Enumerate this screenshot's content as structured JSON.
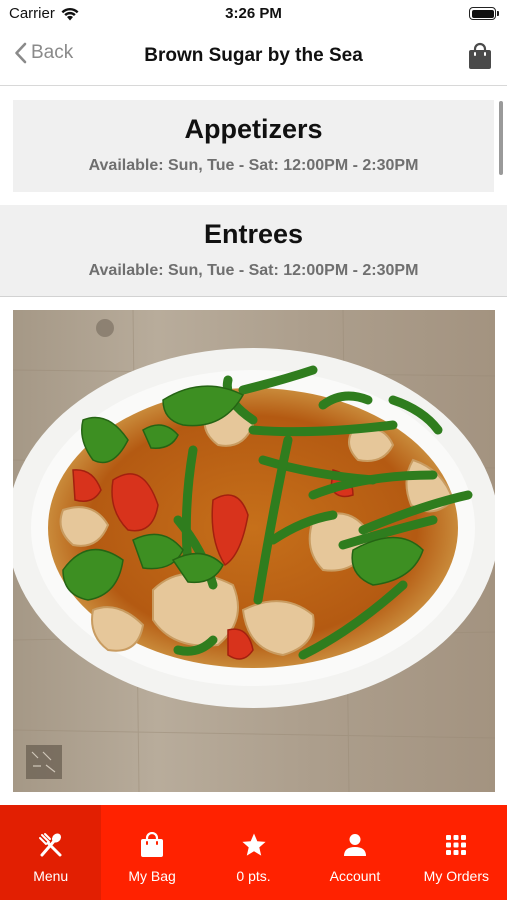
{
  "status_bar": {
    "carrier": "Carrier",
    "time": "3:26 PM"
  },
  "nav": {
    "back_label": "Back",
    "title": "Brown Sugar by the Sea",
    "bag_icon": "shopping-bag-icon"
  },
  "categories": [
    {
      "title": "Appetizers",
      "hours": "Available: Sun, Tue - Sat: 12:00PM - 2:30PM"
    },
    {
      "title": "Entrees",
      "hours": "Available: Sun, Tue - Sat: 12:00PM - 2:30PM"
    }
  ],
  "tab_bar": {
    "accent_color": "#ff2200",
    "active_color": "#e21f02",
    "items": [
      {
        "label": "Menu",
        "icon": "fork-spoon-icon",
        "active": true
      },
      {
        "label": "My Bag",
        "icon": "shopping-bag-icon",
        "active": false
      },
      {
        "label": "0 pts.",
        "icon": "star-icon",
        "active": false
      },
      {
        "label": "Account",
        "icon": "person-icon",
        "active": false
      },
      {
        "label": "My Orders",
        "icon": "grid-icon",
        "active": false
      }
    ]
  }
}
